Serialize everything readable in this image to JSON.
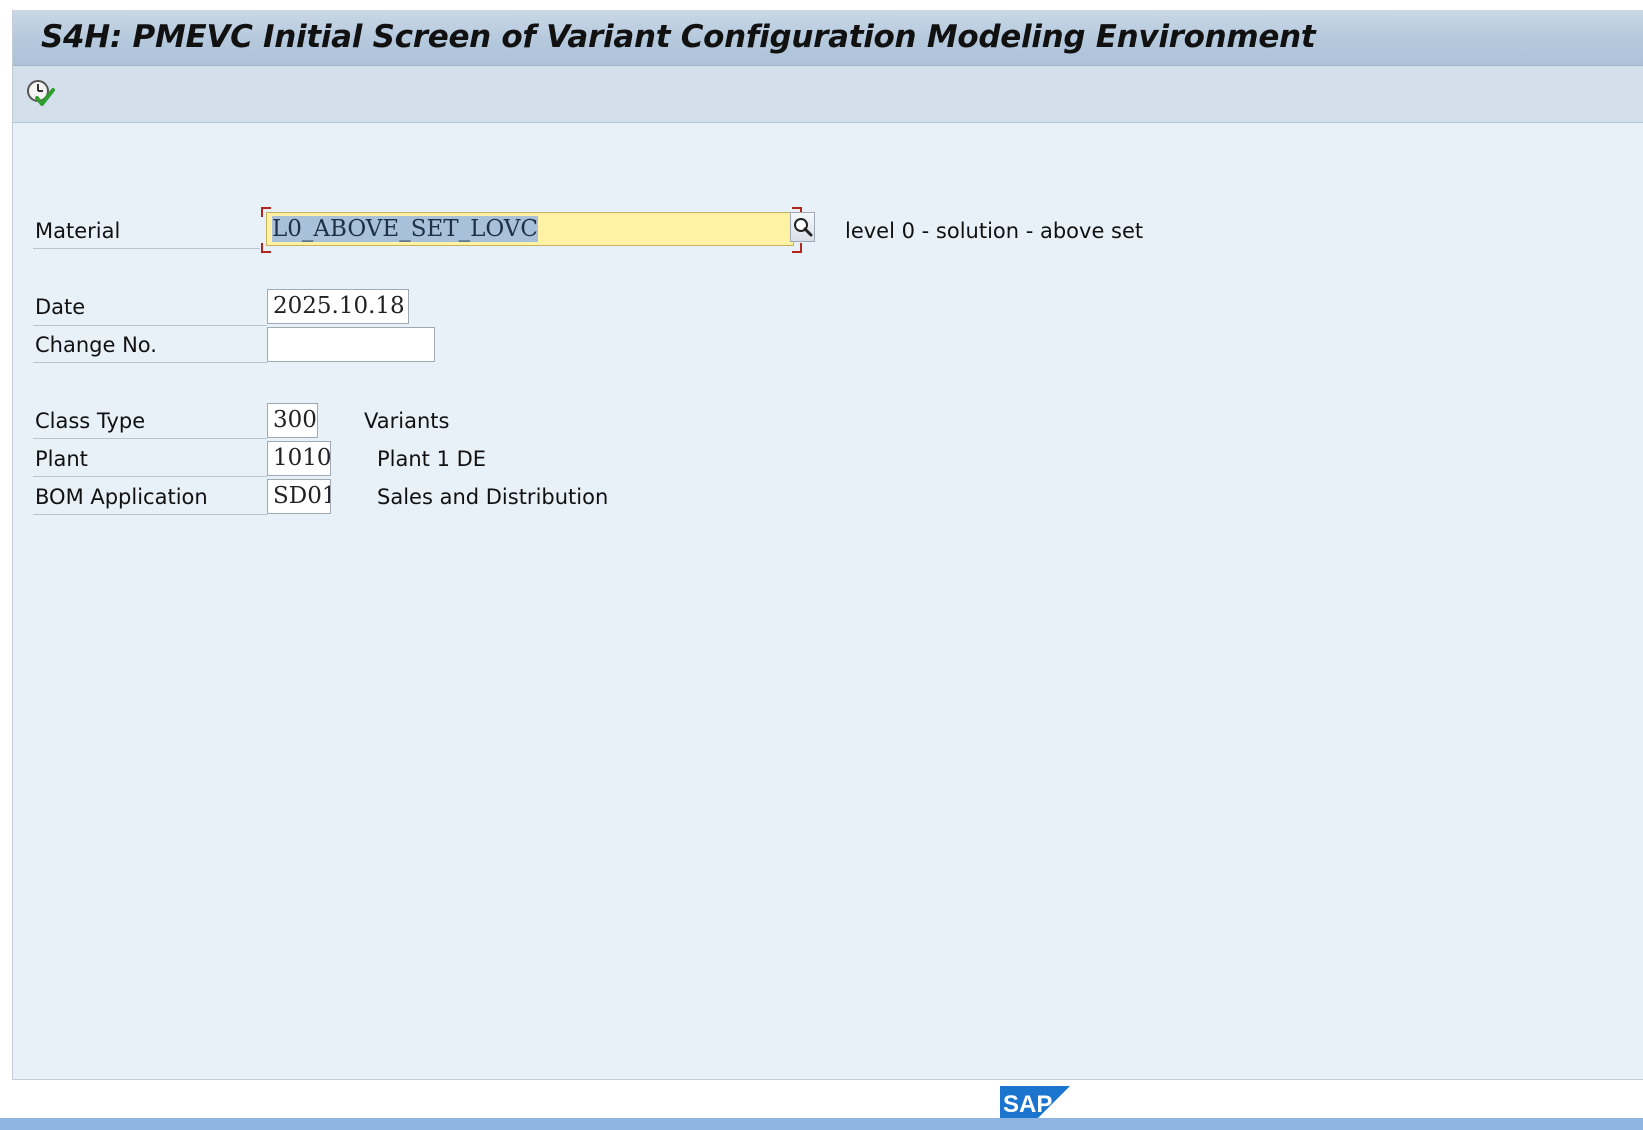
{
  "window": {
    "title": "S4H: PMEVC Initial Screen of Variant Configuration Modeling Environment"
  },
  "toolbar": {
    "execute_icon": "execute-clock-check-icon"
  },
  "form": {
    "material": {
      "label": "Material",
      "value": "L0_ABOVE_SET_LOVC",
      "description": "level 0 - solution - above set"
    },
    "date": {
      "label": "Date",
      "value": "2025.10.18"
    },
    "change_no": {
      "label": "Change No.",
      "value": ""
    },
    "class_type": {
      "label": "Class Type",
      "value": "300",
      "description": "Variants"
    },
    "plant": {
      "label": "Plant",
      "value": "1010",
      "description": "Plant 1 DE"
    },
    "bom_application": {
      "label": "BOM Application",
      "value": "SD01",
      "description": "Sales and Distribution"
    }
  },
  "icons": {
    "search_help": "magnifier-icon",
    "logo": "sap-logo"
  },
  "footer": {
    "logo_text": "SAP"
  },
  "colors": {
    "focus_field": "#fff2a5",
    "title_bar": "#b5c9dd",
    "background": "#e8f0f8",
    "logo_blue": "#1b75cf"
  }
}
